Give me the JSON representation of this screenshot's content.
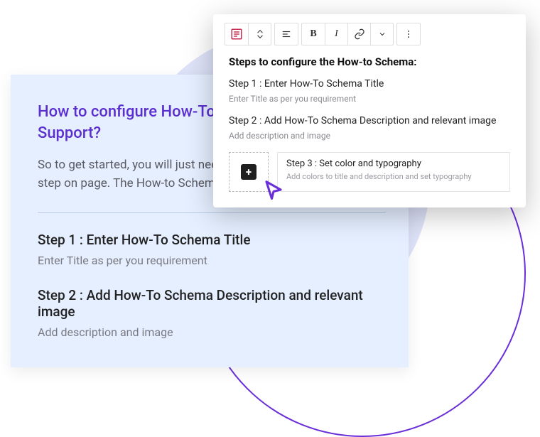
{
  "preview": {
    "title": "How to configure How-To Schema Markup Support?",
    "intro": "So to get started, you will just need to drag-n-drop the How-to step on page. The How-to Schema",
    "steps": [
      {
        "title": "Step 1 : Enter How-To Schema Title",
        "desc": "Enter Title as per you requirement"
      },
      {
        "title": "Step 2 : Add How-To Schema Description and relevant image",
        "desc": "Add description and image"
      }
    ]
  },
  "editor": {
    "heading": "Steps to configure the How-to Schema:",
    "steps": [
      {
        "title": "Step 1 : Enter How-To Schema Title",
        "desc": "Enter Title as per you requirement"
      },
      {
        "title": "Step 2 : Add How-To Schema Description and relevant image",
        "desc": "Add description and image"
      }
    ],
    "step3": {
      "title": "Step 3 : Set color and typography",
      "desc": "Add colors to title and description and set typography"
    }
  },
  "toolbar": {
    "block": "block",
    "transform": "transform",
    "align": "align",
    "bold": "B",
    "italic": "I",
    "link": "link",
    "more_inline": "more-inline",
    "options": "options"
  },
  "colors": {
    "accent": "#5b2fcf",
    "panel_bg": "#e5efff",
    "circle_bg": "#dfe3f9"
  }
}
